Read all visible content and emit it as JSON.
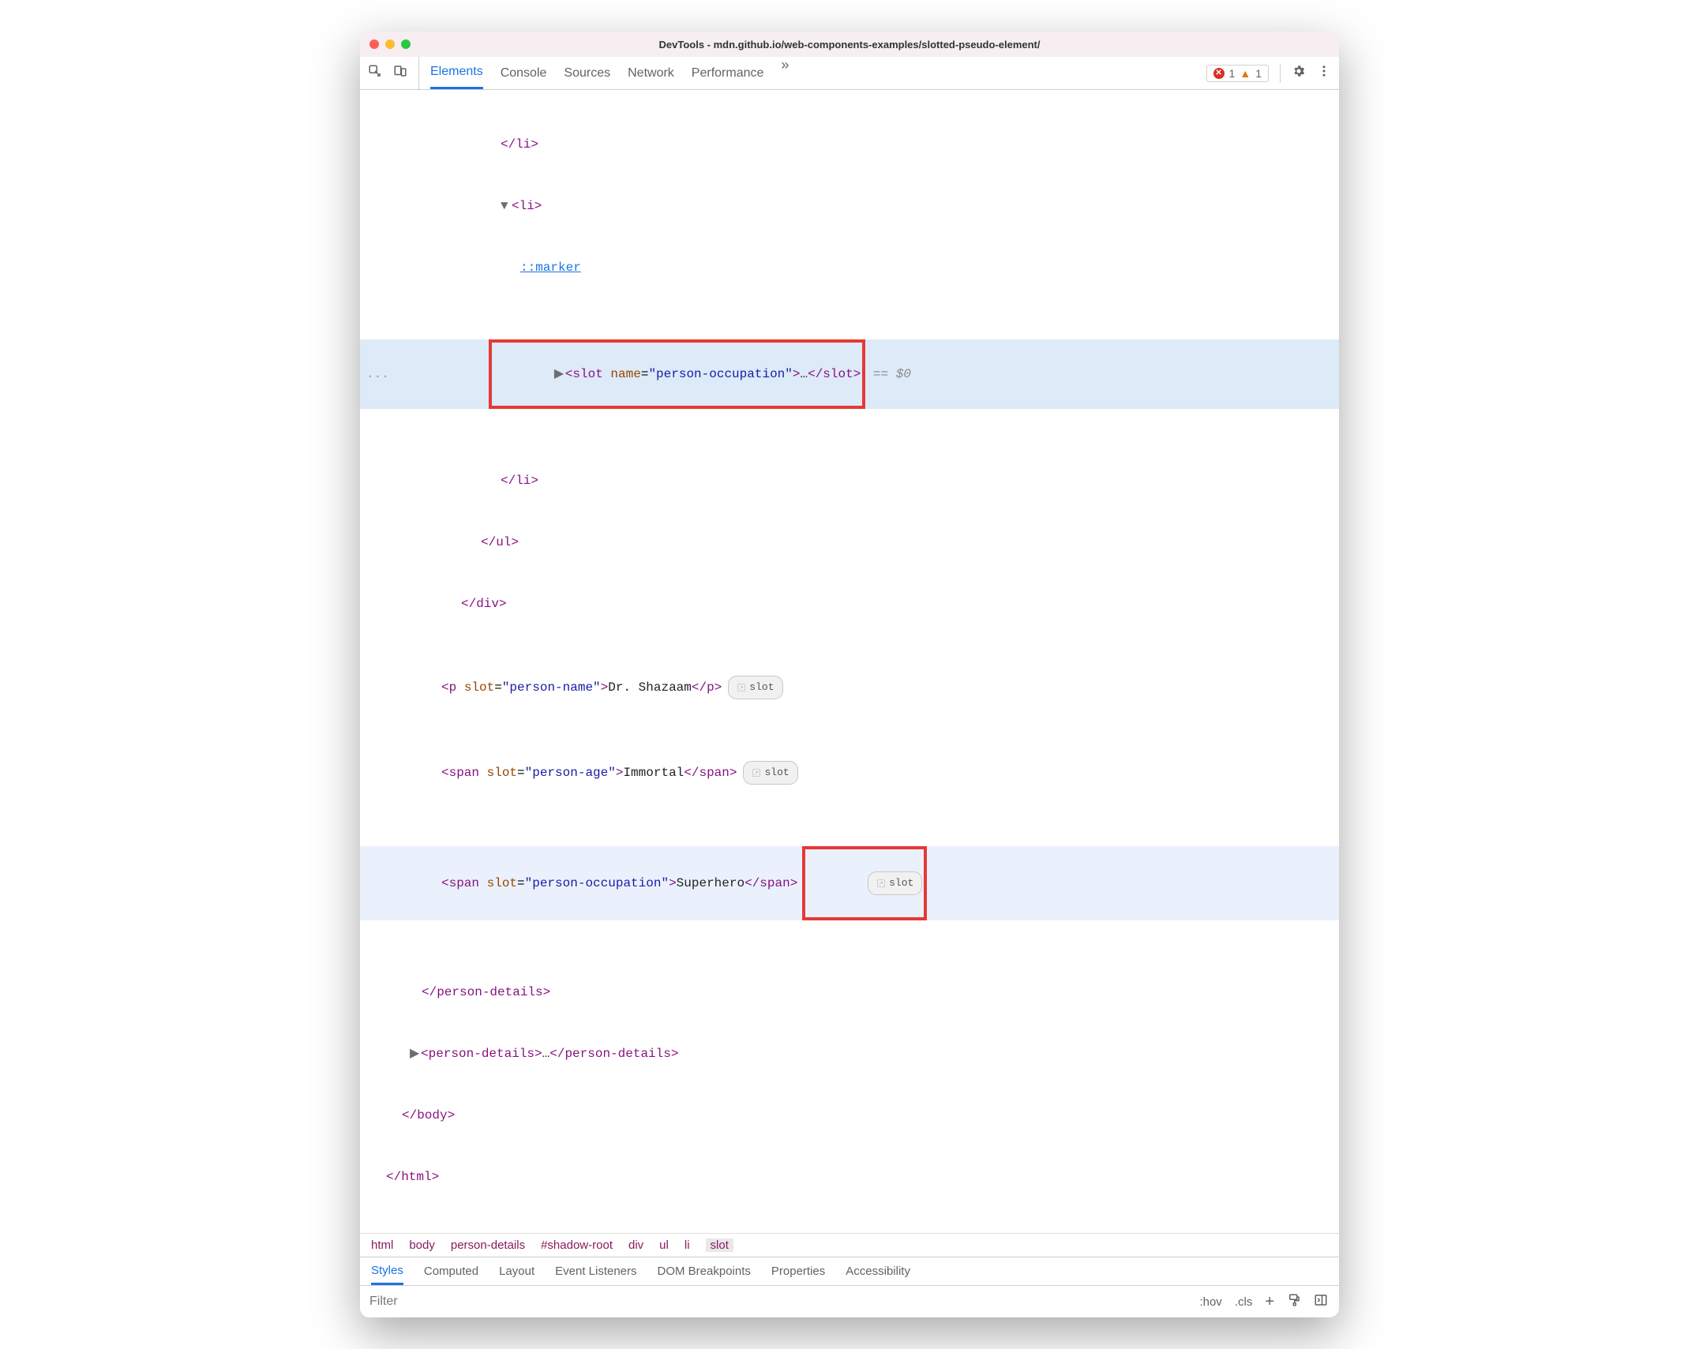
{
  "window": {
    "title": "DevTools - mdn.github.io/web-components-examples/slotted-pseudo-element/"
  },
  "toolbar": {
    "tabs": [
      "Elements",
      "Console",
      "Sources",
      "Network",
      "Performance"
    ],
    "active_tab": "Elements",
    "overflow_glyph": "»",
    "errors": "1",
    "warnings": "1"
  },
  "dom": {
    "row0": {
      "close_li": "</li>"
    },
    "row1": {
      "open_li": "<li>"
    },
    "row2": {
      "pseudo": "::marker"
    },
    "row3": {
      "ellipsis": "...",
      "open": "<slot ",
      "attr": "name",
      "eq": "=",
      "val": "\"person-occupation\"",
      "gt": ">",
      "dots": "…",
      "close": "</slot>",
      "suffix": " == $0"
    },
    "row4": {
      "close_li": "</li>"
    },
    "row5": {
      "close_ul": "</ul>"
    },
    "row6": {
      "close_div": "</div>"
    },
    "row7": {
      "open": "<p ",
      "attr": "slot",
      "eq": "=",
      "val": "\"person-name\"",
      "gt": ">",
      "text": "Dr. Shazaam",
      "close": "</p>",
      "badge": "slot"
    },
    "row8": {
      "open": "<span ",
      "attr": "slot",
      "eq": "=",
      "val": "\"person-age\"",
      "gt": ">",
      "text": "Immortal",
      "close": "</span>",
      "badge": "slot"
    },
    "row9": {
      "open": "<span ",
      "attr": "slot",
      "eq": "=",
      "val": "\"person-occupation\"",
      "gt": ">",
      "text": "Superhero",
      "close": "</span>",
      "badge": "slot"
    },
    "row10": {
      "close": "</person-details>"
    },
    "row11": {
      "open": "<person-details>",
      "dots": "…",
      "close": "</person-details>"
    },
    "row12": {
      "close": "</body>"
    },
    "row13": {
      "close": "</html>"
    }
  },
  "breadcrumb": [
    "html",
    "body",
    "person-details",
    "#shadow-root",
    "div",
    "ul",
    "li",
    "slot"
  ],
  "breadcrumb_active": "slot",
  "subtabs": [
    "Styles",
    "Computed",
    "Layout",
    "Event Listeners",
    "DOM Breakpoints",
    "Properties",
    "Accessibility"
  ],
  "subtab_active": "Styles",
  "filter": {
    "placeholder": "Filter",
    "hov": ":hov",
    "cls": ".cls"
  }
}
